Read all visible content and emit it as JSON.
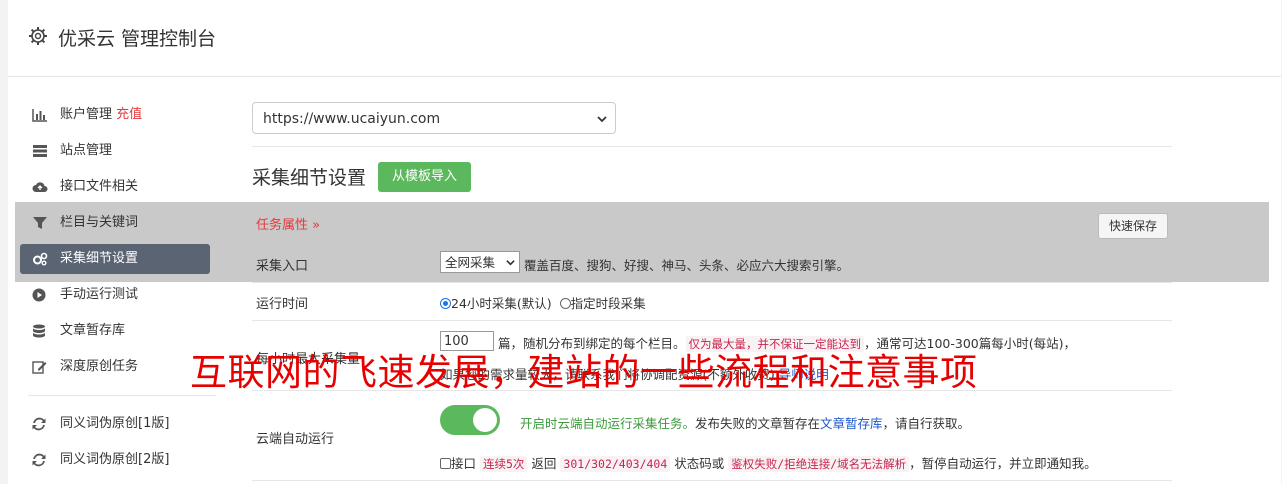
{
  "header": {
    "title": "优采云 管理控制台"
  },
  "sidebar": {
    "items": [
      {
        "label": "账户管理",
        "extra": "充值",
        "icon": "bar-chart-icon"
      },
      {
        "label": "站点管理",
        "icon": "server-icon"
      },
      {
        "label": "接口文件相关",
        "icon": "cloud-upload-icon"
      },
      {
        "label": "栏目与关键词",
        "icon": "filter-icon"
      },
      {
        "label": "采集细节设置",
        "icon": "gears-icon",
        "active": true
      },
      {
        "label": "手动运行测试",
        "icon": "play-circle-icon"
      },
      {
        "label": "文章暂存库",
        "icon": "database-icon"
      },
      {
        "label": "深度原创任务",
        "icon": "edit-icon"
      },
      {
        "label": "同义词伪原创[1版]",
        "icon": "refresh-icon"
      },
      {
        "label": "同义词伪原创[2版]",
        "icon": "refresh-icon"
      }
    ]
  },
  "main": {
    "site_select": "https://www.ucaiyun.com",
    "section_title": "采集细节设置",
    "import_button": "从模板导入",
    "task_attr": "任务属性",
    "task_attr_chevron": "»",
    "quick_save": "快速保存",
    "entry": {
      "label": "采集入口",
      "select": "全网采集",
      "desc": "覆盖百度、搜狗、好搜、神马、头条、必应六大搜索引擎。"
    },
    "runtime": {
      "label": "运行时间",
      "opt1": "24小时采集(默认)",
      "opt2": "指定时段采集"
    },
    "max_collect": {
      "label": "每小时最大采集量",
      "value": "100",
      "line1_a": "篇，随机分布到绑定的每个栏目。",
      "line1_code": "仅为最大量，并不保证一定能达到",
      "line1_b": "，通常可达100-300篇每小时(每站)，",
      "line2_a": "如果您的需求量较大，请联系我们将协调配资源(不额外收费)",
      "line2_link": "导师说明"
    },
    "cloud": {
      "label": "云端自动运行",
      "on_text": "开启时云端自动运行采集任务。",
      "text_a": "发布失败的文章暂存在",
      "link": "文章暂存库",
      "text_b": "，请自行获取。",
      "line2_a": "接口",
      "code1": "连续5次",
      "line2_b": "返回",
      "code2": "301/302/403/404",
      "line2_c": "状态码或",
      "code3": "鉴权失败/拒绝连接/域名无法解析",
      "line2_d": "，暂停自动运行，并立即通知我。"
    }
  },
  "watermark": "互联网的飞速发展，建站的一些流程和注意事项",
  "colors": {
    "accent_green": "#5cb85c",
    "active_bg": "#5b6472",
    "red": "#e4393c",
    "link": "#1a55c9"
  }
}
